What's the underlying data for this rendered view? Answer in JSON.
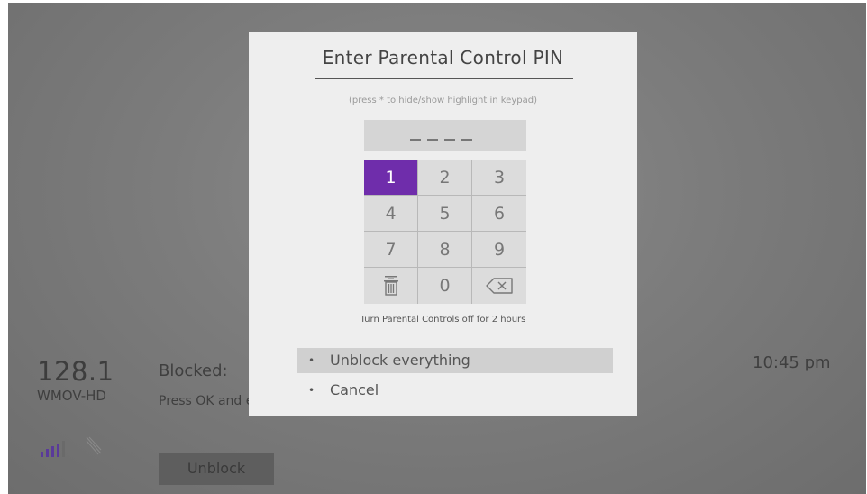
{
  "channel": {
    "number": "128.1",
    "name": "WMOV-HD"
  },
  "blocked": {
    "title": "Blocked:",
    "description": "Press OK and enter your PIN to unblock this channel for the next 2 hours.",
    "unblock_button": "Unblock"
  },
  "clock": "10:45 pm",
  "dialog": {
    "title": "Enter Parental Control PIN",
    "hint": "(press * to hide/show highlight in keypad)",
    "pin_placeholder": "_ _ _ _",
    "keys": [
      "1",
      "2",
      "3",
      "4",
      "5",
      "6",
      "7",
      "8",
      "9",
      "trash-icon",
      "0",
      "backspace-icon"
    ],
    "selected_key": "1",
    "turn_off_text": "Turn Parental Controls off for 2 hours",
    "options": [
      {
        "label": "Unblock everything",
        "selected": true
      },
      {
        "label": "Cancel",
        "selected": false
      }
    ]
  },
  "colors": {
    "accent": "#6f2dab",
    "dialog_bg": "#eeeeee",
    "backdrop": "#7c7c7c"
  }
}
